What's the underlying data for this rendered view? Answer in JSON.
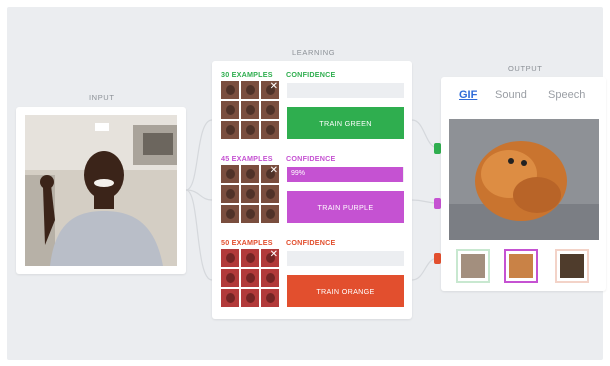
{
  "input": {
    "title": "INPUT"
  },
  "learning": {
    "title": "LEARNING",
    "classes": [
      {
        "examples": "30 EXAMPLES",
        "confidence_label": "CONFIDENCE",
        "confidence_value": "",
        "confidence_fraction": 0.0,
        "button": "TRAIN GREEN",
        "color": "#2fae4f",
        "label_color": "#2fae4f"
      },
      {
        "examples": "45 EXAMPLES",
        "confidence_label": "CONFIDENCE",
        "confidence_value": "99%",
        "confidence_fraction": 0.99,
        "button": "TRAIN PURPLE",
        "color": "#c552d2",
        "label_color": "#c552d2"
      },
      {
        "examples": "50 EXAMPLES",
        "confidence_label": "CONFIDENCE",
        "confidence_value": "",
        "confidence_fraction": 0.0,
        "button": "TRAIN ORANGE",
        "color": "#e24f2e",
        "label_color": "#e24f2e"
      }
    ]
  },
  "output": {
    "title": "OUTPUT",
    "tabs": [
      "GIF",
      "Sound",
      "Speech"
    ],
    "active_tab": "GIF",
    "thumbnail_border_colors": [
      "#c8e8d0",
      "#c552d2",
      "#f3d3c8"
    ]
  }
}
